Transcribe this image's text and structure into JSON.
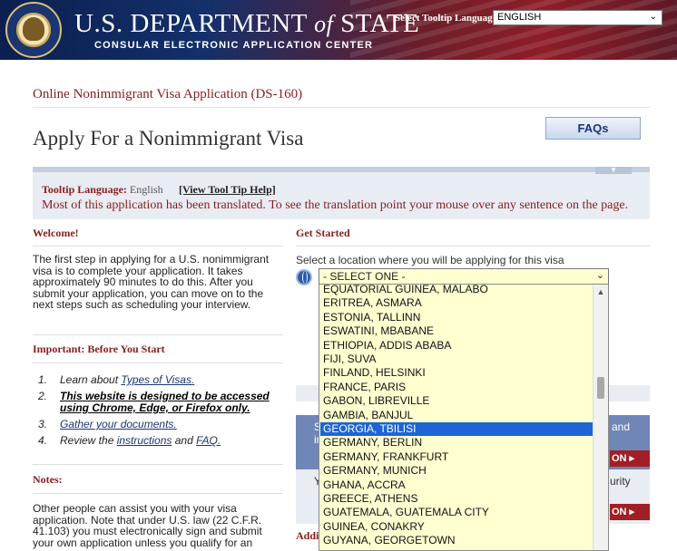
{
  "header": {
    "title_main": "U.S. DEPARTMENT",
    "title_of": "of",
    "title_state": "STATE",
    "subtitle": "CONSULAR ELECTRONIC APPLICATION CENTER",
    "tooltip_language_label": "Select Tooltip Language",
    "tooltip_language_value": "ENGLISH"
  },
  "page": {
    "app_title": "Online Nonimmigrant Visa Application (DS-160)",
    "title": "Apply For a Nonimmigrant Visa",
    "faqs_label": "FAQs"
  },
  "tooltip_band": {
    "label": "Tooltip Language:",
    "value": "English",
    "help_link": "[View Tool Tip Help]",
    "message": "Most of this application has been translated. To see the translation point your mouse over any sentence on the page."
  },
  "welcome": {
    "heading": "Welcome!",
    "text": "The first step in applying for a U.S. nonimmigrant visa is to complete your application. It takes approximately 90 minutes to do this. After you submit your application, you can move on to the next steps such as scheduling your interview."
  },
  "important": {
    "heading": "Important: Before You Start",
    "steps": [
      {
        "num": "1.",
        "pre": "Learn about ",
        "link": "Types of Visas."
      },
      {
        "num": "2.",
        "strong": "This website is designed to be accessed using Chrome, Edge, or Firefox only."
      },
      {
        "num": "3.",
        "link": "Gather your documents."
      },
      {
        "num": "4.",
        "pre": "Review the ",
        "link": "instructions",
        "mid": " and ",
        "link2": "FAQ."
      }
    ]
  },
  "notes": {
    "heading": "Notes:",
    "text": "Other people can assist you with your visa application. Note that under U.S. law (22 C.F.R. 41.103) you must electronically sign and submit your own application unless you qualify for an"
  },
  "get_started": {
    "heading": "Get Started",
    "prompt": "Select a location where you will be applying for this visa",
    "select_value": "- SELECT ONE -",
    "options": [
      "EQUATORIAL GUINEA, MALABO",
      "ERITREA, ASMARA",
      "ESTONIA, TALLINN",
      "ESWATINI, MBABANE",
      "ETHIOPIA, ADDIS ABABA",
      "FIJI, SUVA",
      "FINLAND, HELSINKI",
      "FRANCE, PARIS",
      "GABON, LIBREVILLE",
      "GAMBIA, BANJUL",
      "GEORGIA, TBILISI",
      "GERMANY, BERLIN",
      "GERMANY, FRANKFURT",
      "GERMANY, MUNICH",
      "GHANA, ACCRA",
      "GREECE, ATHENS",
      "GUATEMALA, GUATEMALA CITY",
      "GUINEA, CONAKRY",
      "GUYANA, GEORGETOWN"
    ],
    "selected_option": "GEORGIA, TBILISI"
  },
  "behind": {
    "box1_left": "S",
    "box1_left2": "in",
    "box1_right": "and",
    "btn1": "ON",
    "box2_left": "Y",
    "box2_right": "urity",
    "btn2": "ON",
    "addi": "Addi"
  }
}
